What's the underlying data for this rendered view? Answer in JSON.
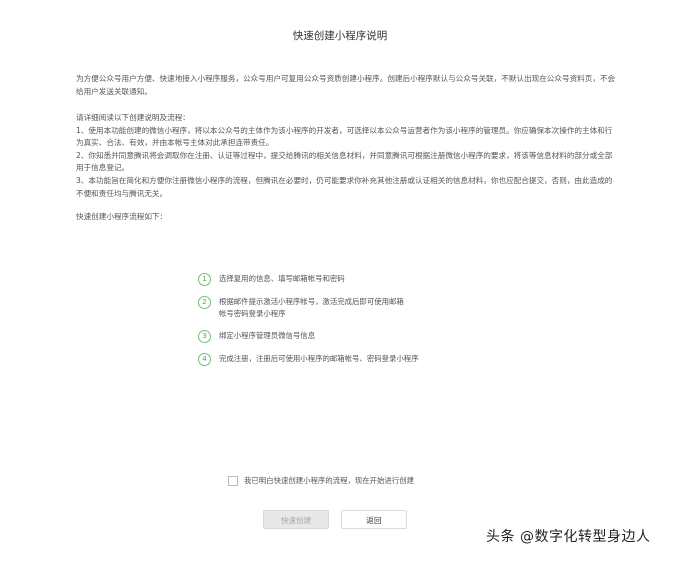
{
  "page": {
    "title": "快速创建小程序说明"
  },
  "intro": {
    "text": "为方便公众号用户方便、快速地接入小程序服务，公众号用户可复用公众号资质创建小程序。创建后小程序默认与公众号关联，不默认出现在公众号资料页，不会给用户发送关联通知。"
  },
  "rules": {
    "heading": "请详细阅读以下创建说明及流程：",
    "items": [
      "1、使用本功能创建的微信小程序，将以本公众号的主体作为该小程序的开发者，可选择以本公众号运营者作为该小程序的管理员。你应确保本次操作的主体和行为真实、合法、有效，并由本帐号主体对此承担连带责任。",
      "2、你知悉并同意腾讯将会调取你在注册、认证等过程中，提交给腾讯的相关信息材料，并同意腾讯可根据注册微信小程序的要求，将该等信息材料的部分或全部用于信息登记。",
      "3、本功能旨在简化和方便你注册微信小程序的流程，但腾讯在必要时，仍可能要求你补充其他注册或认证相关的信息材料，你也应配合提交，否则，由此造成的不便和责任均与腾讯无关。"
    ]
  },
  "flow": {
    "label": "快速创建小程序流程如下：",
    "steps": [
      {
        "num": "1",
        "text": "选择复用的信息、填写邮箱帐号和密码"
      },
      {
        "num": "2",
        "text": "根据邮件提示激活小程序帐号，激活完成后即可使用邮箱帐号密码登录小程序"
      },
      {
        "num": "3",
        "text": "绑定小程序管理员微信号信息"
      },
      {
        "num": "4",
        "text": "完成注册，注册后可使用小程序的邮箱帐号、密码登录小程序"
      }
    ]
  },
  "agreement": {
    "label": "我已明白快速创建小程序的流程，现在开始进行创建",
    "checked": false
  },
  "buttons": {
    "create_label": "快速创建",
    "back_label": "返回"
  },
  "watermark": {
    "text": "头条 @数字化转型身边人"
  },
  "colors": {
    "step_accent": "#4aa64f",
    "disabled_button_bg": "#e8e8e8",
    "text": "#555555"
  }
}
